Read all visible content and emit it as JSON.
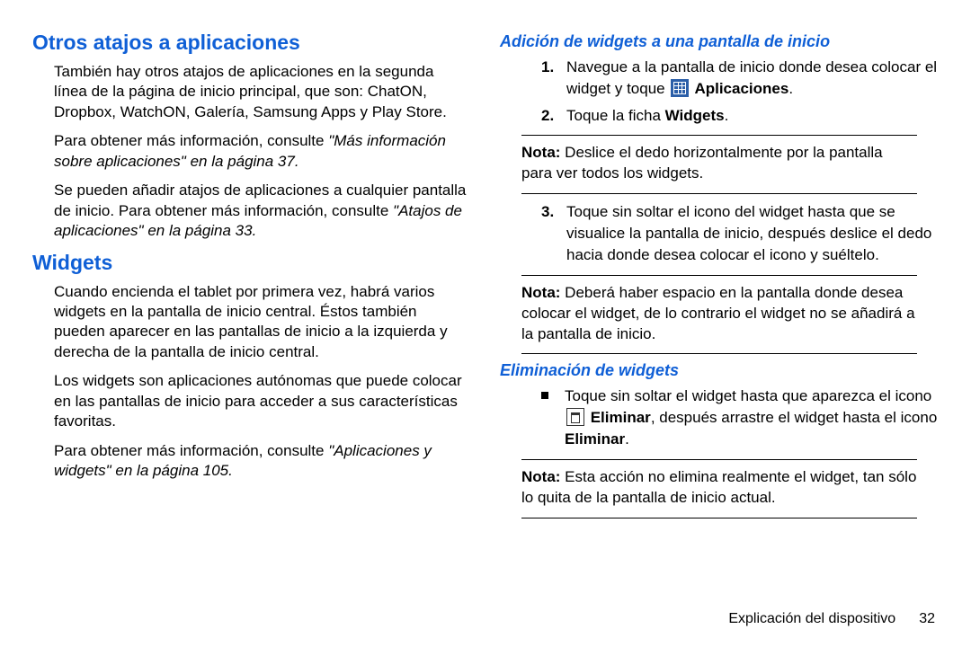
{
  "left": {
    "h1_otros": "Otros atajos a aplicaciones",
    "p1": "También hay otros atajos de aplicaciones en la segunda línea de la página de inicio principal, que son: ChatON, Dropbox, WatchON, Galería, Samsung Apps y Play Store.",
    "p2_a": "Para obtener más información, consulte ",
    "p2_it": "\"Más información sobre aplicaciones\"",
    "p2_b": " en la página 37.",
    "p3_a": "Se pueden añadir atajos de aplicaciones a cualquier pantalla de inicio. Para obtener más información, consulte ",
    "p3_it": "\"Atajos de aplicaciones\"",
    "p3_b": " en la página 33.",
    "h1_widgets": "Widgets",
    "p4": "Cuando encienda el tablet por primera vez, habrá varios widgets en la pantalla de inicio central. Éstos también pueden aparecer en las pantallas de inicio a la izquierda y derecha de la pantalla de inicio central.",
    "p5": "Los widgets son aplicaciones autónomas que puede colocar en las pantallas de inicio para acceder a sus características favoritas.",
    "p6_a": "Para obtener más información, consulte ",
    "p6_it": "\"Aplicaciones y widgets\"",
    "p6_b": " en la página 105."
  },
  "right": {
    "h2_add": "Adición de widgets a una pantalla de inicio",
    "step1_num": "1.",
    "step1_a": "Navegue a la pantalla de inicio donde desea colocar el widget y toque ",
    "step1_b": " Aplicaciones",
    "step1_c": ".",
    "step2_num": "2.",
    "step2_a": "Toque la ficha ",
    "step2_b": "Widgets",
    "step2_c": ".",
    "nota_lbl": "Nota:",
    "nota1": " Deslice el dedo horizontalmente por la pantalla para ver todos los widgets.",
    "step3_num": "3.",
    "step3": "Toque sin soltar el icono del widget hasta que se visualice la pantalla de inicio, después deslice el dedo hacia donde desea colocar el icono y suéltelo.",
    "nota2": " Deberá haber espacio en la pantalla donde desea colocar el widget, de lo contrario el widget no se añadirá a la pantalla de inicio.",
    "h2_del": "Eliminación de widgets",
    "bul_a": "Toque sin soltar el widget hasta que aparezca el icono ",
    "bul_b": " Eliminar",
    "bul_c": ", después arrastre el widget hasta el icono ",
    "bul_d": "Eliminar",
    "bul_e": ".",
    "nota3": " Esta acción no elimina realmente el widget, tan sólo lo quita de la pantalla de inicio actual."
  },
  "footer": {
    "section": "Explicación del dispositivo",
    "page": "32"
  }
}
